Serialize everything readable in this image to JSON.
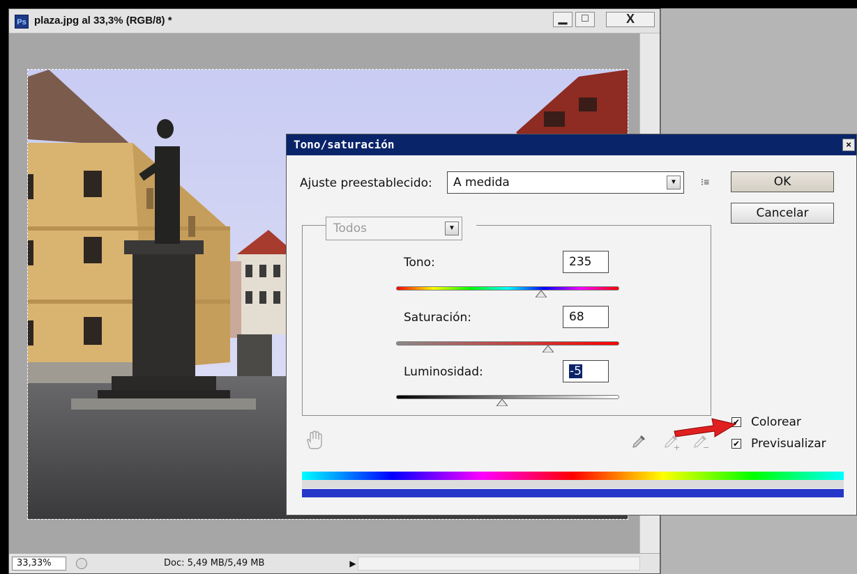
{
  "document": {
    "title": "plaza.jpg al 33,3% (RGB/8) *",
    "app_icon_text": "Ps",
    "minimize_glyph": "▁",
    "maximize_glyph": "□",
    "close_glyph": "X",
    "zoom": "33,33%",
    "doc_size": "Doc: 5,49 MB/5,49 MB",
    "status_arrow": "▶"
  },
  "dialog": {
    "title": "Tono/saturación",
    "close_glyph": "×",
    "preset_label": "Ajuste preestablecido:",
    "preset_value": "A medida",
    "dropdown_glyph": "▼",
    "preset_options_glyph": "⁝≡",
    "ok_label": "OK",
    "cancel_label": "Cancelar",
    "edit_value": "Todos",
    "fields": {
      "hue_label": "Tono:",
      "hue_value": "235",
      "saturation_label": "Saturación:",
      "saturation_value": "68",
      "lightness_label": "Luminosidad:",
      "lightness_value": "-5"
    },
    "levels": {
      "hue": 0.65,
      "saturation": 0.68,
      "lightness": 0.475
    },
    "colorize_label": "Colorear",
    "colorize_checked": true,
    "preview_label": "Previsualizar",
    "preview_checked": true,
    "check_glyph": "✔"
  },
  "colors": {
    "dialog_title_bg": "#0a246a",
    "arrow": "#e02020",
    "bottom_bar": "#2537c9"
  }
}
